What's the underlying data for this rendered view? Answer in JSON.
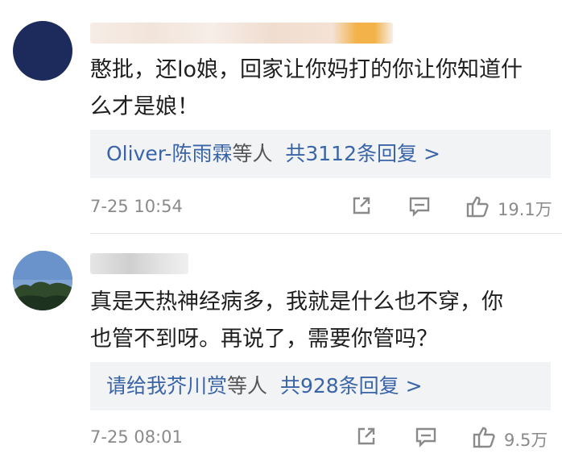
{
  "comments": [
    {
      "text_line1": "憨批，还lo娘，回家让你妈打的你让你知道什",
      "text_line2": "么才是娘！",
      "reply_users": "Oliver-陈雨霖",
      "reply_suffix": "等人",
      "reply_count": "共3112条回复 >",
      "time": "7-25 10:54",
      "likes": "19.1万"
    },
    {
      "text_line1": "真是天热神经病多，我就是什么也不穿，你",
      "text_line2": "也管不到呀。再说了，需要你管吗？",
      "reply_users": "请给我芥川赏",
      "reply_suffix": "等人",
      "reply_count": "共928条回复 >",
      "time": "7-25 08:01",
      "likes": "9.5万"
    }
  ],
  "icons": {
    "share": "share-icon",
    "comment": "comment-icon",
    "like": "thumbs-up-icon"
  },
  "colors": {
    "link": "#3a64a8",
    "meta": "#8a8a8a",
    "reply_bg": "#f2f3f5"
  }
}
